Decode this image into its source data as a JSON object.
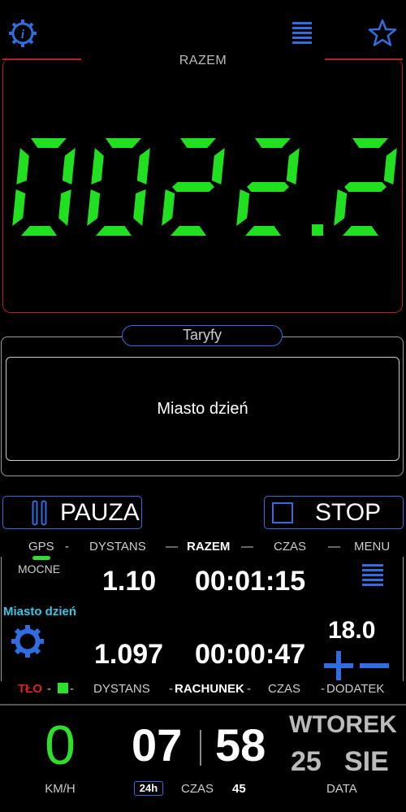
{
  "header": {
    "info_icon": "info-gear-icon",
    "menu_icon": "menu-lines-icon",
    "favorite_icon": "star-icon"
  },
  "display": {
    "label": "RAZEM",
    "value": "0022.2",
    "digit_color": "#20e020"
  },
  "tariffs": {
    "title": "Taryfy",
    "selected": "Miasto dzień"
  },
  "controls": {
    "pause_label": "PAUZA",
    "stop_label": "STOP"
  },
  "info": {
    "gps_label": "GPS",
    "gps_status": "MOCNE",
    "header_distance": "DYSTANS",
    "header_total": "RAZEM",
    "header_time": "CZAS",
    "header_menu": "MENU",
    "total_distance": "1.10",
    "total_time": "00:01:15",
    "tariff_name": "Miasto dzień",
    "extra_amount": "18.0",
    "bill_distance": "1.097",
    "bill_time": "00:00:47",
    "footer_bg": "TŁO",
    "footer_distance": "DYSTANS",
    "footer_bill": "RACHUNEK",
    "footer_time": "CZAS",
    "footer_extra": "DODATEK"
  },
  "status": {
    "speed": "0",
    "speed_unit": "KM/H",
    "hours": "07",
    "minutes": "58",
    "seconds": "45",
    "format_badge": "24h",
    "time_label": "CZAS",
    "weekday": "WTOREK",
    "day": "25",
    "month": "SIE",
    "date_label": "DATA"
  },
  "colors": {
    "accent_blue": "#2f6de0",
    "frame_red": "#b5212a",
    "speed_green": "#2ee02e",
    "tariff_cyan": "#36c6e8",
    "bg_red": "#e02020"
  }
}
